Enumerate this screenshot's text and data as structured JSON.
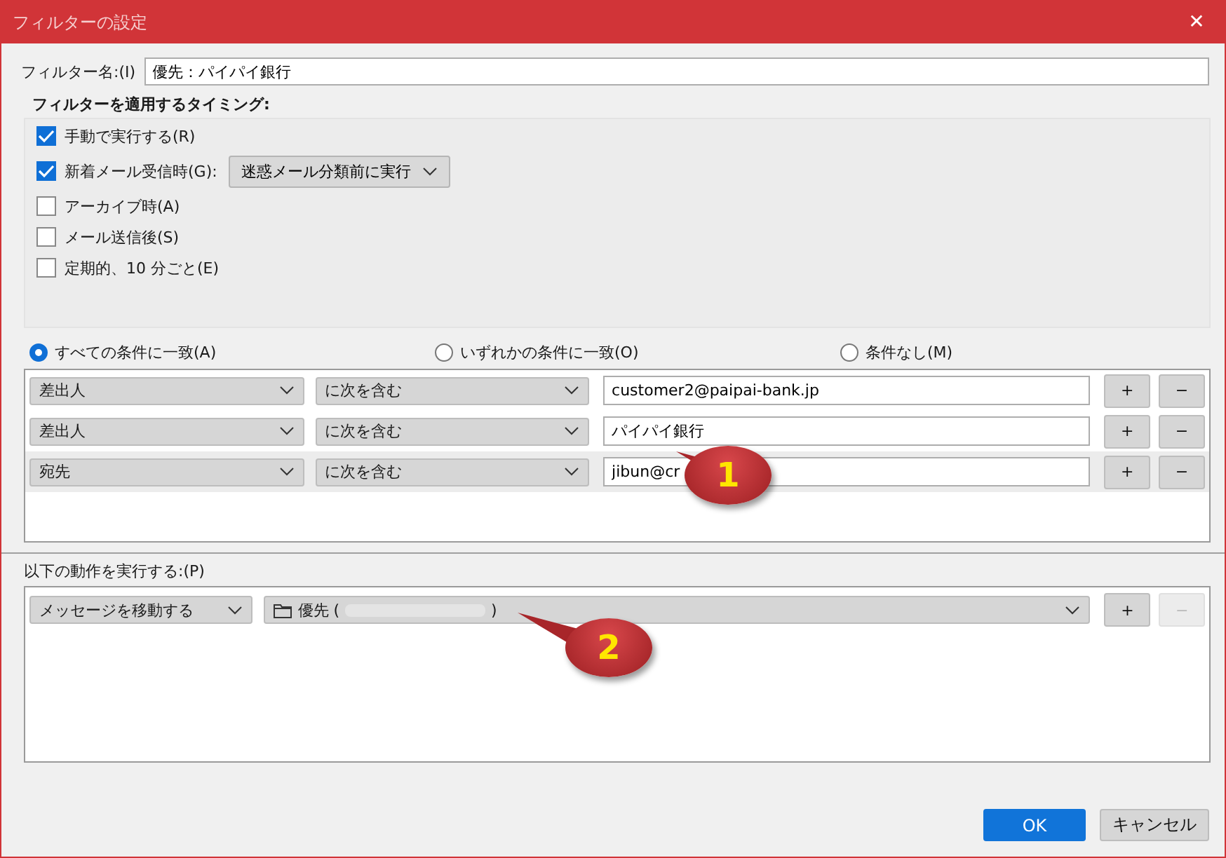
{
  "window": {
    "title": "フィルターの設定",
    "close": "✕"
  },
  "filter_name": {
    "label": "フィルター名:(I)",
    "value": "優先：パイパイ銀行"
  },
  "timing": {
    "label": "フィルターを適用するタイミング:",
    "options": [
      {
        "label": "手動で実行する(R)",
        "checked": true
      },
      {
        "label": "新着メール受信時(G):",
        "checked": true,
        "dropdown": "迷惑メール分類前に実行"
      },
      {
        "label": "アーカイブ時(A)",
        "checked": false
      },
      {
        "label": "メール送信後(S)",
        "checked": false
      },
      {
        "label": "定期的、10 分ごと(E)",
        "checked": false
      }
    ]
  },
  "match": [
    {
      "label": "すべての条件に一致(A)",
      "selected": true
    },
    {
      "label": "いずれかの条件に一致(O)",
      "selected": false
    },
    {
      "label": "条件なし(M)",
      "selected": false
    }
  ],
  "conditions": [
    {
      "field": "差出人",
      "operator": "に次を含む",
      "value": "customer2@paipai-bank.jp",
      "add": "+",
      "remove": "−",
      "selected": false
    },
    {
      "field": "差出人",
      "operator": "に次を含む",
      "value": "パイパイ銀行",
      "add": "+",
      "remove": "−",
      "selected": false
    },
    {
      "field": "宛先",
      "operator": "に次を含む",
      "value": "jibun@cr",
      "add": "+",
      "remove": "−",
      "selected": true
    }
  ],
  "actions": {
    "label": "以下の動作を実行する:(P)",
    "rows": [
      {
        "action": "メッセージを移動する",
        "folder_start": "優先 (",
        "folder_end": ")",
        "add": "+",
        "remove": "−",
        "remove_disabled": true
      }
    ]
  },
  "callouts": [
    {
      "number": "1"
    },
    {
      "number": "2"
    }
  ],
  "buttons": [
    {
      "label": "OK",
      "kind": "primary"
    },
    {
      "label": "キャンセル",
      "kind": "default"
    }
  ]
}
